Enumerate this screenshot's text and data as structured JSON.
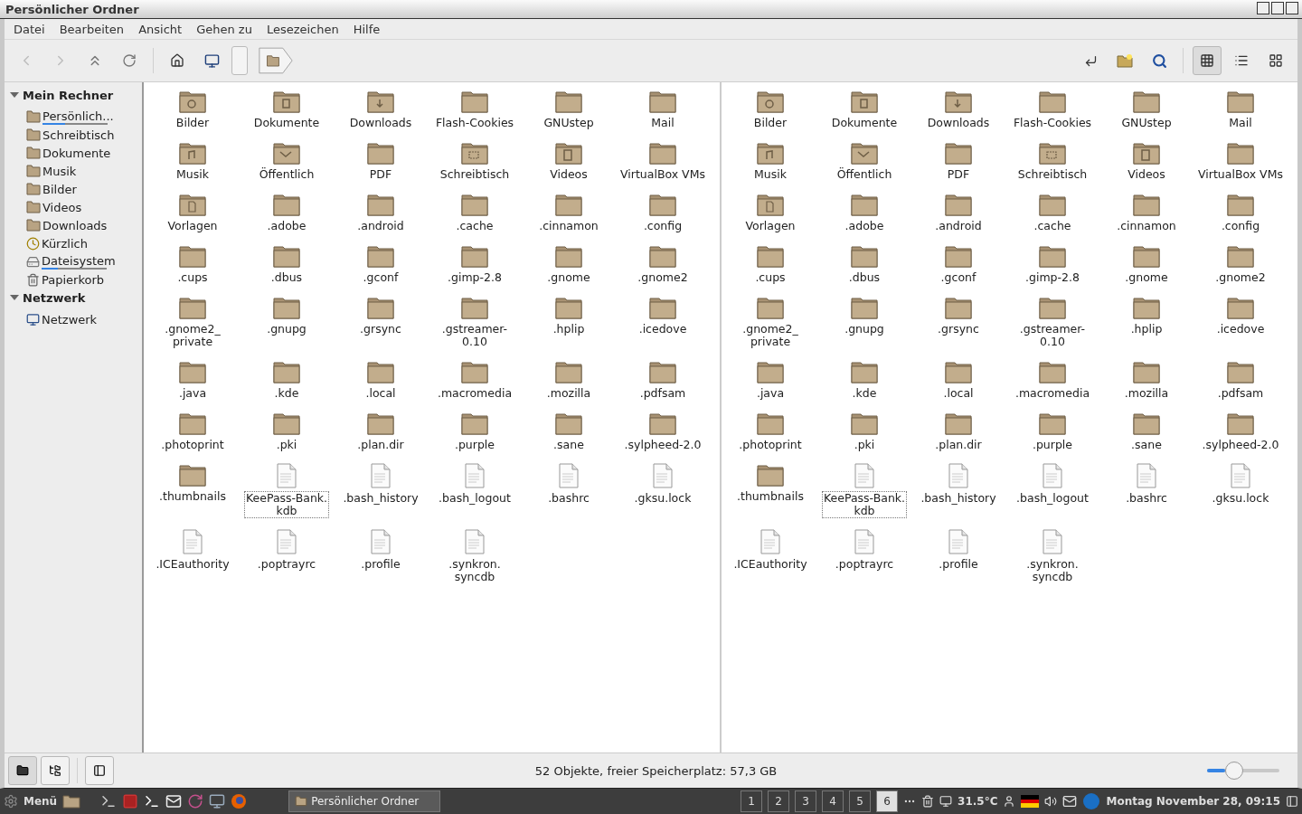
{
  "window": {
    "title": "Persönlicher Ordner"
  },
  "menu": [
    "Datei",
    "Bearbeiten",
    "Ansicht",
    "Gehen zu",
    "Lesezeichen",
    "Hilfe"
  ],
  "view_modes": [
    {
      "kind": "icons",
      "selected": true
    },
    {
      "kind": "list",
      "selected": false
    },
    {
      "kind": "compact",
      "selected": false
    }
  ],
  "sidebar": {
    "sections": [
      {
        "title": "Mein Rechner",
        "expanded": true,
        "items": [
          {
            "label": "Persönlich...",
            "kind": "home",
            "level": 0.35
          },
          {
            "label": "Schreibtisch",
            "kind": "desktop"
          },
          {
            "label": "Dokumente",
            "kind": "documents"
          },
          {
            "label": "Musik",
            "kind": "music"
          },
          {
            "label": "Bilder",
            "kind": "pictures"
          },
          {
            "label": "Videos",
            "kind": "videos"
          },
          {
            "label": "Downloads",
            "kind": "downloads"
          },
          {
            "label": "Kürzlich",
            "kind": "recent"
          },
          {
            "label": "Dateisystem",
            "kind": "filesystem",
            "level": 0.25
          },
          {
            "label": "Papierkorb",
            "kind": "trash"
          }
        ]
      },
      {
        "title": "Netzwerk",
        "expanded": true,
        "items": [
          {
            "label": "Netzwerk",
            "kind": "network"
          }
        ]
      }
    ]
  },
  "panes": [
    {
      "items": [
        {
          "name": "Bilder",
          "kind": "pictures",
          "focused": false
        },
        {
          "name": "Dokumente",
          "kind": "documents",
          "focused": false
        },
        {
          "name": "Downloads",
          "kind": "downloads",
          "focused": false
        },
        {
          "name": "Flash-Cookies",
          "kind": "folder",
          "focused": false
        },
        {
          "name": "GNUstep",
          "kind": "folder",
          "focused": false
        },
        {
          "name": "Mail",
          "kind": "folder",
          "focused": false
        },
        {
          "name": "Musik",
          "kind": "music",
          "focused": false
        },
        {
          "name": "Öffentlich",
          "kind": "public",
          "focused": false
        },
        {
          "name": "PDF",
          "kind": "folder",
          "focused": false
        },
        {
          "name": "Schreibtisch",
          "kind": "desktop",
          "focused": false
        },
        {
          "name": "Videos",
          "kind": "videos",
          "focused": false
        },
        {
          "name": "VirtualBox VMs",
          "kind": "folder",
          "focused": false
        },
        {
          "name": "Vorlagen",
          "kind": "templates",
          "focused": false
        },
        {
          "name": ".adobe",
          "kind": "folder",
          "focused": false
        },
        {
          "name": ".android",
          "kind": "folder",
          "focused": false
        },
        {
          "name": ".cache",
          "kind": "folder",
          "focused": false
        },
        {
          "name": ".cinnamon",
          "kind": "folder",
          "focused": false
        },
        {
          "name": ".config",
          "kind": "folder",
          "focused": false
        },
        {
          "name": ".cups",
          "kind": "folder",
          "focused": false
        },
        {
          "name": ".dbus",
          "kind": "folder",
          "focused": false
        },
        {
          "name": ".gconf",
          "kind": "folder",
          "focused": false
        },
        {
          "name": ".gimp-2.8",
          "kind": "folder",
          "focused": false
        },
        {
          "name": ".gnome",
          "kind": "folder",
          "focused": false
        },
        {
          "name": ".gnome2",
          "kind": "folder",
          "focused": false
        },
        {
          "name": ".gnome2_\nprivate",
          "kind": "folder",
          "focused": false
        },
        {
          "name": ".gnupg",
          "kind": "folder",
          "focused": false
        },
        {
          "name": ".grsync",
          "kind": "folder",
          "focused": false
        },
        {
          "name": ".gstreamer-\n0.10",
          "kind": "folder",
          "focused": false
        },
        {
          "name": ".hplip",
          "kind": "folder",
          "focused": false
        },
        {
          "name": ".icedove",
          "kind": "folder",
          "focused": false
        },
        {
          "name": ".java",
          "kind": "folder",
          "focused": false
        },
        {
          "name": ".kde",
          "kind": "folder",
          "focused": false
        },
        {
          "name": ".local",
          "kind": "folder",
          "focused": false
        },
        {
          "name": ".macromedia",
          "kind": "folder",
          "focused": false
        },
        {
          "name": ".mozilla",
          "kind": "folder",
          "focused": false
        },
        {
          "name": ".pdfsam",
          "kind": "folder",
          "focused": false
        },
        {
          "name": ".photoprint",
          "kind": "folder",
          "focused": false
        },
        {
          "name": ".pki",
          "kind": "folder",
          "focused": false
        },
        {
          "name": ".plan.dir",
          "kind": "folder",
          "focused": false
        },
        {
          "name": ".purple",
          "kind": "folder",
          "focused": false
        },
        {
          "name": ".sane",
          "kind": "folder",
          "focused": false
        },
        {
          "name": ".sylpheed-2.0",
          "kind": "folder",
          "focused": false
        },
        {
          "name": ".thumbnails",
          "kind": "folder",
          "focused": false
        },
        {
          "name": "KeePass-Bank.\nkdb",
          "kind": "file",
          "focused": true
        },
        {
          "name": ".bash_history",
          "kind": "file",
          "focused": false
        },
        {
          "name": ".bash_logout",
          "kind": "file",
          "focused": false
        },
        {
          "name": ".bashrc",
          "kind": "file",
          "focused": false
        },
        {
          "name": ".gksu.lock",
          "kind": "file",
          "focused": false
        },
        {
          "name": ".ICEauthority",
          "kind": "file",
          "focused": false
        },
        {
          "name": ".poptrayrc",
          "kind": "file",
          "focused": false
        },
        {
          "name": ".profile",
          "kind": "file",
          "focused": false
        },
        {
          "name": ".synkron.\nsyncdb",
          "kind": "file",
          "focused": false
        }
      ]
    },
    {
      "items": [
        {
          "name": "Bilder",
          "kind": "pictures",
          "focused": false
        },
        {
          "name": "Dokumente",
          "kind": "documents",
          "focused": false
        },
        {
          "name": "Downloads",
          "kind": "downloads",
          "focused": false
        },
        {
          "name": "Flash-Cookies",
          "kind": "folder",
          "focused": false
        },
        {
          "name": "GNUstep",
          "kind": "folder",
          "focused": false
        },
        {
          "name": "Mail",
          "kind": "folder",
          "focused": false
        },
        {
          "name": "Musik",
          "kind": "music",
          "focused": false
        },
        {
          "name": "Öffentlich",
          "kind": "public",
          "focused": false
        },
        {
          "name": "PDF",
          "kind": "folder",
          "focused": false
        },
        {
          "name": "Schreibtisch",
          "kind": "desktop",
          "focused": false
        },
        {
          "name": "Videos",
          "kind": "videos",
          "focused": false
        },
        {
          "name": "VirtualBox VMs",
          "kind": "folder",
          "focused": false
        },
        {
          "name": "Vorlagen",
          "kind": "templates",
          "focused": false
        },
        {
          "name": ".adobe",
          "kind": "folder",
          "focused": false
        },
        {
          "name": ".android",
          "kind": "folder",
          "focused": false
        },
        {
          "name": ".cache",
          "kind": "folder",
          "focused": false
        },
        {
          "name": ".cinnamon",
          "kind": "folder",
          "focused": false
        },
        {
          "name": ".config",
          "kind": "folder",
          "focused": false
        },
        {
          "name": ".cups",
          "kind": "folder",
          "focused": false
        },
        {
          "name": ".dbus",
          "kind": "folder",
          "focused": false
        },
        {
          "name": ".gconf",
          "kind": "folder",
          "focused": false
        },
        {
          "name": ".gimp-2.8",
          "kind": "folder",
          "focused": false
        },
        {
          "name": ".gnome",
          "kind": "folder",
          "focused": false
        },
        {
          "name": ".gnome2",
          "kind": "folder",
          "focused": false
        },
        {
          "name": ".gnome2_\nprivate",
          "kind": "folder",
          "focused": false
        },
        {
          "name": ".gnupg",
          "kind": "folder",
          "focused": false
        },
        {
          "name": ".grsync",
          "kind": "folder",
          "focused": false
        },
        {
          "name": ".gstreamer-\n0.10",
          "kind": "folder",
          "focused": false
        },
        {
          "name": ".hplip",
          "kind": "folder",
          "focused": false
        },
        {
          "name": ".icedove",
          "kind": "folder",
          "focused": false
        },
        {
          "name": ".java",
          "kind": "folder",
          "focused": false
        },
        {
          "name": ".kde",
          "kind": "folder",
          "focused": false
        },
        {
          "name": ".local",
          "kind": "folder",
          "focused": false
        },
        {
          "name": ".macromedia",
          "kind": "folder",
          "focused": false
        },
        {
          "name": ".mozilla",
          "kind": "folder",
          "focused": false
        },
        {
          "name": ".pdfsam",
          "kind": "folder",
          "focused": false
        },
        {
          "name": ".photoprint",
          "kind": "folder",
          "focused": false
        },
        {
          "name": ".pki",
          "kind": "folder",
          "focused": false
        },
        {
          "name": ".plan.dir",
          "kind": "folder",
          "focused": false
        },
        {
          "name": ".purple",
          "kind": "folder",
          "focused": false
        },
        {
          "name": ".sane",
          "kind": "folder",
          "focused": false
        },
        {
          "name": ".sylpheed-2.0",
          "kind": "folder",
          "focused": false
        },
        {
          "name": ".thumbnails",
          "kind": "folder",
          "focused": false
        },
        {
          "name": "KeePass-Bank.\nkdb",
          "kind": "file",
          "focused": true
        },
        {
          "name": ".bash_history",
          "kind": "file",
          "focused": false
        },
        {
          "name": ".bash_logout",
          "kind": "file",
          "focused": false
        },
        {
          "name": ".bashrc",
          "kind": "file",
          "focused": false
        },
        {
          "name": ".gksu.lock",
          "kind": "file",
          "focused": false
        },
        {
          "name": ".ICEauthority",
          "kind": "file",
          "focused": false
        },
        {
          "name": ".poptrayrc",
          "kind": "file",
          "focused": false
        },
        {
          "name": ".profile",
          "kind": "file",
          "focused": false
        },
        {
          "name": ".synkron.\nsyncdb",
          "kind": "file",
          "focused": false
        }
      ]
    }
  ],
  "status_bar": {
    "sidebar_modes": [
      {
        "kind": "places",
        "selected": true
      },
      {
        "kind": "tree",
        "selected": false
      }
    ],
    "text": "52 Objekte, freier Speicherplatz: 57,3 GB",
    "zoom": {
      "level": 0.25
    }
  },
  "taskbar": {
    "menu_label": "Menü",
    "window_button": "Persönlicher Ordner",
    "workspaces": [
      {
        "label": "1",
        "selected": false
      },
      {
        "label": "2",
        "selected": false
      },
      {
        "label": "3",
        "selected": false
      },
      {
        "label": "4",
        "selected": false
      },
      {
        "label": "5",
        "selected": false
      },
      {
        "label": "6",
        "selected": true
      }
    ],
    "temperature": "31.5°C",
    "clock": "Montag November 28, 09:15"
  }
}
